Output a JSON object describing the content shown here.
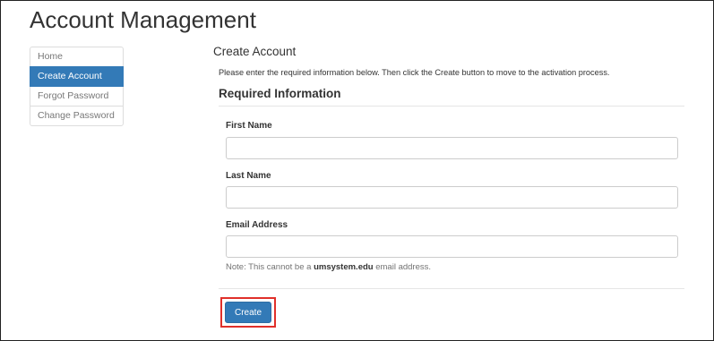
{
  "header": {
    "title": "Account Management"
  },
  "sidebar": {
    "items": [
      {
        "label": "Home",
        "active": false
      },
      {
        "label": "Create Account",
        "active": true
      },
      {
        "label": "Forgot Password",
        "active": false
      },
      {
        "label": "Change Password",
        "active": false
      }
    ]
  },
  "main": {
    "title": "Create Account",
    "intro": "Please enter the required information below. Then click the Create button to move to the activation process.",
    "section_heading": "Required Information",
    "fields": [
      {
        "label": "First Name",
        "value": "",
        "placeholder": ""
      },
      {
        "label": "Last Name",
        "value": "",
        "placeholder": ""
      },
      {
        "label": "Email Address",
        "value": "",
        "placeholder": ""
      }
    ],
    "note": {
      "prefix": "Note: This cannot be a ",
      "emphasis": "umsystem.edu",
      "suffix": " email address."
    },
    "create_button_label": "Create"
  },
  "colors": {
    "primary": "#337ab7",
    "highlight_border": "#e0302a"
  }
}
